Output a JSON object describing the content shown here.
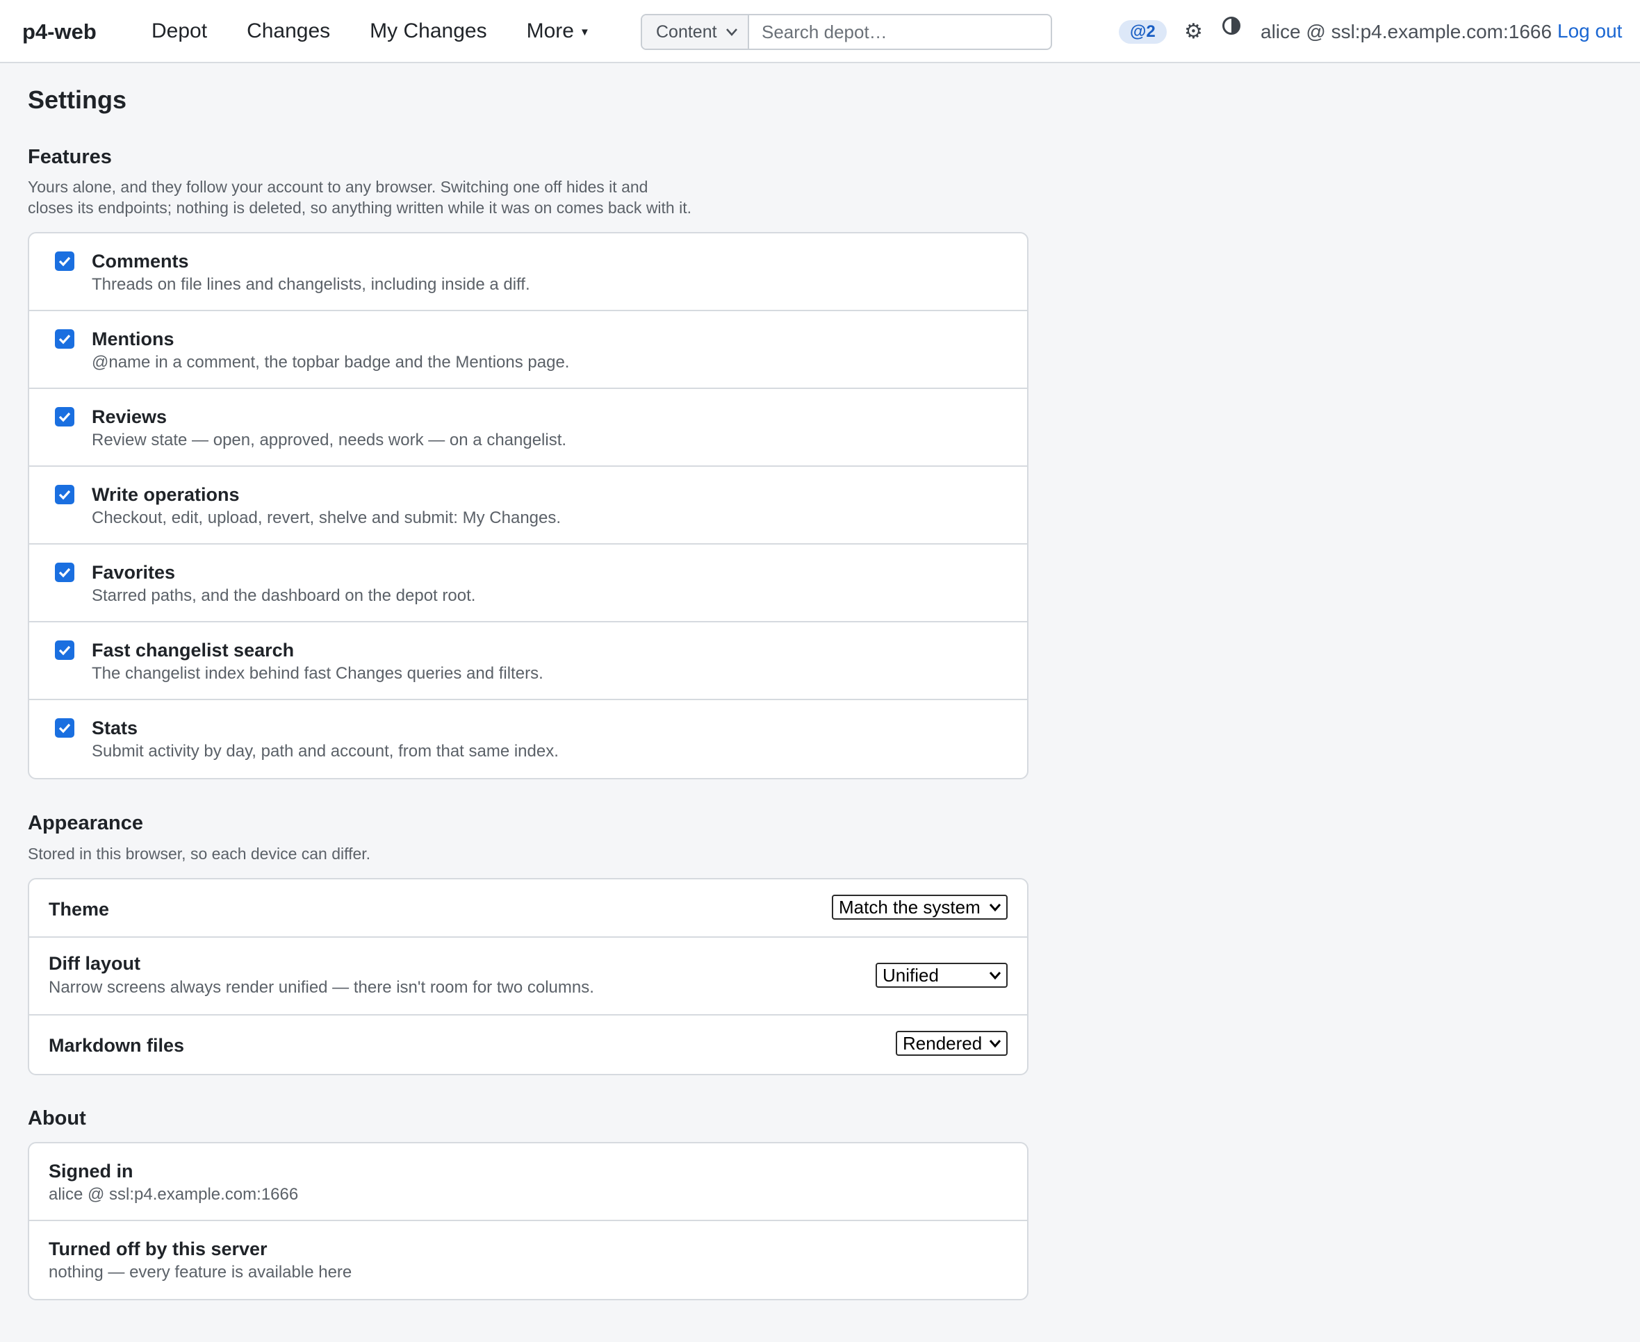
{
  "topbar": {
    "brand": "p4-web",
    "nav": [
      "Depot",
      "Changes",
      "My Changes",
      "More"
    ],
    "search": {
      "scope": "Content",
      "placeholder": "Search depot…"
    },
    "mentions_badge": "@2",
    "account": "alice @ ssl:p4.example.com:1666",
    "logout": "Log out",
    "icons": {
      "settings": "gear-icon",
      "theme": "contrast-icon",
      "more": "caret-down-icon"
    }
  },
  "page": {
    "title": "Settings"
  },
  "features": {
    "title": "Features",
    "description": "Yours alone, and they follow your account to any browser. Switching one off hides it and closes its endpoints; nothing is deleted, so anything written while it was on comes back with it.",
    "items": [
      {
        "title": "Comments",
        "desc": "Threads on file lines and changelists, including inside a diff.",
        "checked": true
      },
      {
        "title": "Mentions",
        "desc": "@name in a comment, the topbar badge and the Mentions page.",
        "checked": true
      },
      {
        "title": "Reviews",
        "desc": "Review state — open, approved, needs work — on a changelist.",
        "checked": true
      },
      {
        "title": "Write operations",
        "desc": "Checkout, edit, upload, revert, shelve and submit: My Changes.",
        "checked": true
      },
      {
        "title": "Favorites",
        "desc": "Starred paths, and the dashboard on the depot root.",
        "checked": true
      },
      {
        "title": "Fast changelist search",
        "desc": "The changelist index behind fast Changes queries and filters.",
        "checked": true
      },
      {
        "title": "Stats",
        "desc": "Submit activity by day, path and account, from that same index.",
        "checked": true
      }
    ]
  },
  "appearance": {
    "title": "Appearance",
    "description": "Stored in this browser, so each device can differ.",
    "theme": {
      "label": "Theme",
      "value": "Match the system"
    },
    "diff_layout": {
      "label": "Diff layout",
      "desc": "Narrow screens always render unified — there isn't room for two columns.",
      "value": "Unified"
    },
    "markdown": {
      "label": "Markdown files",
      "value": "Rendered"
    }
  },
  "about": {
    "title": "About",
    "signed_in": {
      "label": "Signed in",
      "value": "alice @ ssl:p4.example.com:1666"
    },
    "turned_off": {
      "label": "Turned off by this server",
      "value": "nothing — every feature is available here"
    }
  },
  "colors": {
    "accent": "#1a6fe0",
    "link": "#1a66d2",
    "badge_bg": "#dde8f8",
    "badge_text": "#1a5fc4",
    "background": "#f5f6f8"
  }
}
